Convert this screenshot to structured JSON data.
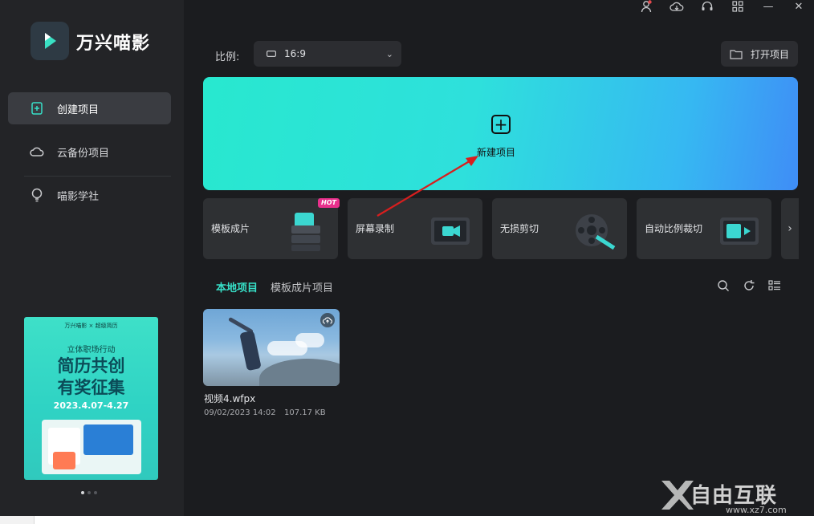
{
  "app": {
    "name": "万兴喵影"
  },
  "window_controls": {
    "minimize": "—",
    "close": "✕"
  },
  "sidebar": {
    "items": [
      {
        "label": "创建项目",
        "icon": "add-file-icon",
        "active": true
      },
      {
        "label": "云备份项目",
        "icon": "cloud-icon",
        "active": false
      },
      {
        "label": "喵影学社",
        "icon": "bulb-icon",
        "active": false
      }
    ],
    "promo": {
      "partners": "万兴喵影 × 超级简历",
      "subtitle": "立体职场行动",
      "headline_1": "简历共创",
      "headline_2": "有奖征集",
      "dates": "2023.4.07-4.27"
    }
  },
  "toolbar": {
    "ratio_label": "比例:",
    "ratio_value": "16:9",
    "open_project": "打开项目"
  },
  "hero": {
    "label": "新建项目"
  },
  "features": [
    {
      "label": "模板成片",
      "badge": "HOT"
    },
    {
      "label": "屏幕录制"
    },
    {
      "label": "无损剪切"
    },
    {
      "label": "自动比例裁切"
    }
  ],
  "tabs": [
    {
      "label": "本地项目",
      "active": true
    },
    {
      "label": "模板成片项目",
      "active": false
    }
  ],
  "projects": [
    {
      "name": "视频4.wfpx",
      "date": "09/02/2023 14:02",
      "size": "107.17 KB"
    }
  ],
  "watermark": {
    "text": "自由互联",
    "url": "www.xz7.com"
  },
  "colors": {
    "accent": "#37dfc7",
    "hero_start": "#28e8cf",
    "hero_end": "#3f8df6",
    "sidebar": "#232427",
    "background": "#1b1c1f"
  }
}
